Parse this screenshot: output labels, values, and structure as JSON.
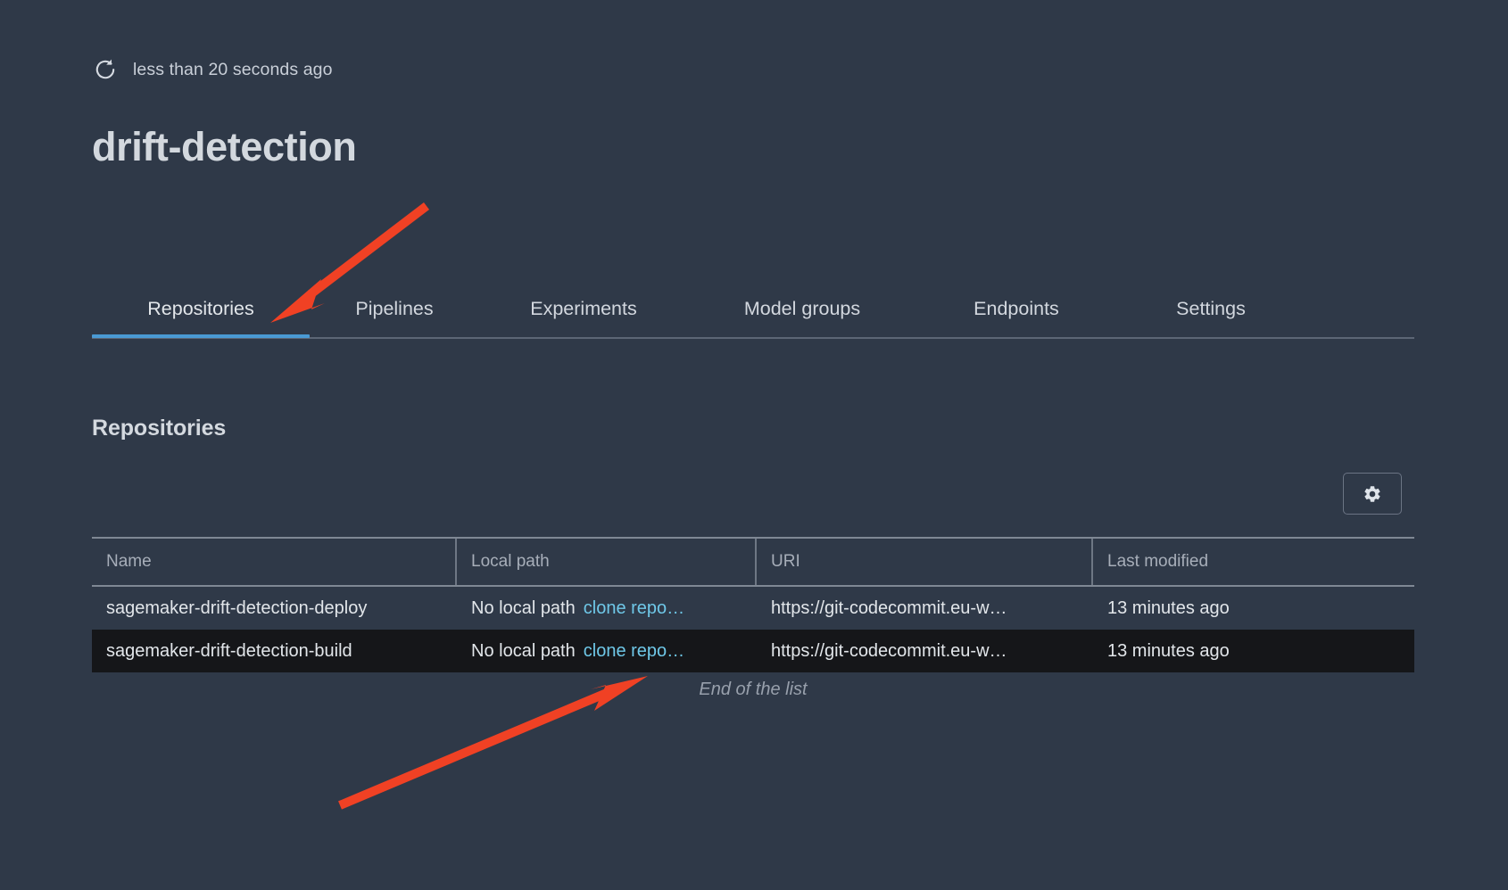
{
  "header": {
    "refresh_icon": "refresh-icon",
    "refresh_label": "less than 20 seconds ago",
    "title": "drift-detection"
  },
  "tabs": {
    "active_index": 0,
    "items": [
      {
        "label": "Repositories"
      },
      {
        "label": "Pipelines"
      },
      {
        "label": "Experiments"
      },
      {
        "label": "Model groups"
      },
      {
        "label": "Endpoints"
      },
      {
        "label": "Settings"
      }
    ]
  },
  "section": {
    "heading": "Repositories",
    "settings_button_icon": "gear-icon"
  },
  "table": {
    "columns": [
      {
        "label": "Name"
      },
      {
        "label": "Local path"
      },
      {
        "label": "URI"
      },
      {
        "label": "Last modified"
      }
    ],
    "rows": [
      {
        "name": "sagemaker-drift-detection-deploy",
        "local_path": "No local path",
        "clone_link": "clone repo…",
        "uri": "https://git-codecommit.eu-w…",
        "last_modified": "13 minutes ago",
        "selected": false
      },
      {
        "name": "sagemaker-drift-detection-build",
        "local_path": "No local path",
        "clone_link": "clone repo…",
        "uri": "https://git-codecommit.eu-w…",
        "last_modified": "13 minutes ago",
        "selected": true
      }
    ],
    "footer": "End of the list"
  },
  "colors": {
    "background": "#2f3948",
    "selected_row": "#151619",
    "accent_tab_underline": "#4a9ad4",
    "link": "#6fc8e8",
    "annotation_arrow": "#f04124"
  }
}
